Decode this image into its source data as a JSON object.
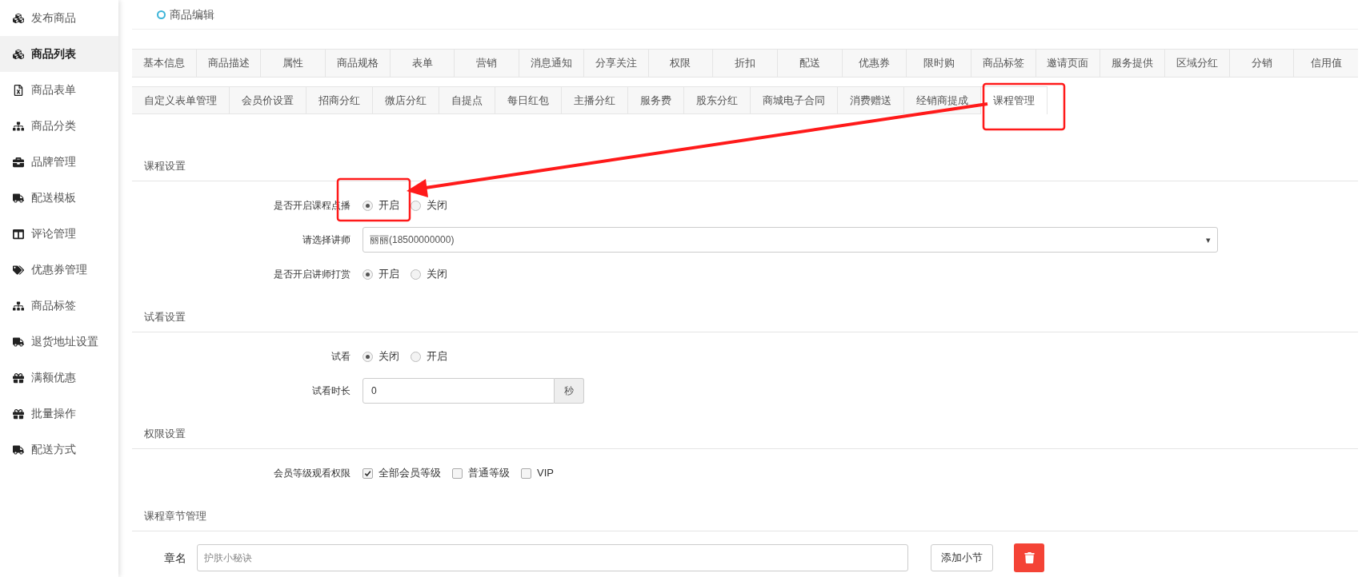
{
  "sidebar": {
    "items": [
      {
        "label": "发布商品",
        "selected": false
      },
      {
        "label": "商品列表",
        "selected": true
      },
      {
        "label": "商品表单",
        "selected": false
      },
      {
        "label": "商品分类",
        "selected": false
      },
      {
        "label": "品牌管理",
        "selected": false
      },
      {
        "label": "配送模板",
        "selected": false
      },
      {
        "label": "评论管理",
        "selected": false
      },
      {
        "label": "优惠券管理",
        "selected": false
      },
      {
        "label": "商品标签",
        "selected": false
      },
      {
        "label": "退货地址设置",
        "selected": false
      },
      {
        "label": "满额优惠",
        "selected": false
      },
      {
        "label": "批量操作",
        "selected": false
      },
      {
        "label": "配送方式",
        "selected": false
      }
    ]
  },
  "header": {
    "title": "商品编辑"
  },
  "tab_rows": [
    {
      "tabs": [
        {
          "label": "基本信息",
          "selected": false
        },
        {
          "label": "商品描述",
          "selected": false
        },
        {
          "label": "属性",
          "selected": false
        },
        {
          "label": "商品规格",
          "selected": false
        },
        {
          "label": "表单",
          "selected": false
        },
        {
          "label": "营销",
          "selected": false
        },
        {
          "label": "消息通知",
          "selected": false
        },
        {
          "label": "分享关注",
          "selected": false
        },
        {
          "label": "权限",
          "selected": false
        },
        {
          "label": "折扣",
          "selected": false
        },
        {
          "label": "配送",
          "selected": false
        },
        {
          "label": "优惠券",
          "selected": false
        },
        {
          "label": "限时购",
          "selected": false
        },
        {
          "label": "商品标签",
          "selected": false
        },
        {
          "label": "邀请页面",
          "selected": false
        },
        {
          "label": "服务提供",
          "selected": false
        },
        {
          "label": "区域分红",
          "selected": false
        },
        {
          "label": "分销",
          "selected": false
        },
        {
          "label": "信用值",
          "selected": false
        }
      ]
    },
    {
      "tabs": [
        {
          "label": "自定义表单管理",
          "selected": false
        },
        {
          "label": "会员价设置",
          "selected": false
        },
        {
          "label": "招商分红",
          "selected": false
        },
        {
          "label": "微店分红",
          "selected": false
        },
        {
          "label": "自提点",
          "selected": false
        },
        {
          "label": "每日红包",
          "selected": false
        },
        {
          "label": "主播分红",
          "selected": false
        },
        {
          "label": "服务费",
          "selected": false
        },
        {
          "label": "股东分红",
          "selected": false
        },
        {
          "label": "商城电子合同",
          "selected": false
        },
        {
          "label": "消费赠送",
          "selected": false
        },
        {
          "label": "经销商提成",
          "selected": false
        },
        {
          "label": "课程管理",
          "selected": true
        }
      ]
    }
  ],
  "sections": [
    {
      "title": "课程设置",
      "fields": [
        {
          "kind": "radio",
          "label": "是否开启课程点播",
          "options": [
            {
              "label": "开启",
              "selected": true
            },
            {
              "label": "关闭",
              "selected": false
            }
          ]
        },
        {
          "kind": "select",
          "label": "请选择讲师",
          "value": "丽丽(18500000000)",
          "caret": "▾"
        },
        {
          "kind": "radio",
          "label": "是否开启讲师打赏",
          "options": [
            {
              "label": "开启",
              "selected": true
            },
            {
              "label": "关闭",
              "selected": false
            }
          ]
        }
      ]
    },
    {
      "title": "试看设置",
      "fields": [
        {
          "kind": "radio",
          "label": "试看",
          "options": [
            {
              "label": "关闭",
              "selected": true
            },
            {
              "label": "开启",
              "selected": false
            }
          ]
        },
        {
          "kind": "input",
          "label": "试看时长",
          "value": "0",
          "addon": "秒"
        }
      ]
    },
    {
      "title": "权限设置",
      "fields": [
        {
          "kind": "checkbox",
          "label": "会员等级观看权限",
          "options": [
            {
              "label": "全部会员等级",
              "checked": true
            },
            {
              "label": "普通等级",
              "checked": false
            },
            {
              "label": "VIP",
              "checked": false
            }
          ]
        }
      ]
    },
    {
      "title": "课程章节管理",
      "chapters": [
        {
          "label": "章名",
          "placeholder": "护肤小秘诀",
          "button": "添加小节"
        }
      ]
    }
  ]
}
